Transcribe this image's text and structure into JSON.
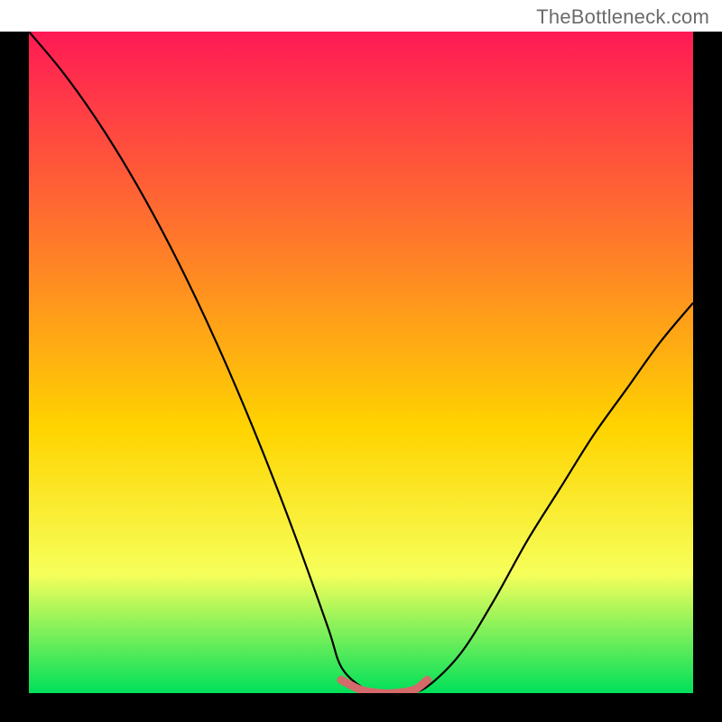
{
  "attribution": "TheBottleneck.com",
  "chart_data": {
    "type": "line",
    "title": "",
    "xlabel": "",
    "ylabel": "",
    "xlim": [
      0,
      100
    ],
    "ylim": [
      0,
      100
    ],
    "series": [
      {
        "name": "curve",
        "x": [
          0,
          5,
          10,
          15,
          20,
          25,
          30,
          35,
          40,
          45,
          47,
          50,
          53,
          55,
          57,
          60,
          65,
          70,
          75,
          80,
          85,
          90,
          95,
          100
        ],
        "y": [
          100,
          94,
          87,
          79,
          70,
          60,
          49,
          37,
          24,
          10,
          4,
          1,
          0,
          0,
          0,
          1,
          6,
          14,
          23,
          31,
          39,
          46,
          53,
          59
        ]
      },
      {
        "name": "flat-highlight",
        "x": [
          47,
          50,
          53,
          55,
          58,
          60
        ],
        "y": [
          2,
          0.5,
          0,
          0,
          0.5,
          2
        ]
      }
    ],
    "background_gradient": {
      "top": "#ff1a55",
      "mid1": "#ff7a2a",
      "mid2": "#ffd400",
      "mid3": "#f6ff5a",
      "bottom": "#00e05a"
    },
    "frame_thickness_px": 32,
    "flat_highlight_color": "#d46a6a",
    "curve_color": "#000000"
  }
}
